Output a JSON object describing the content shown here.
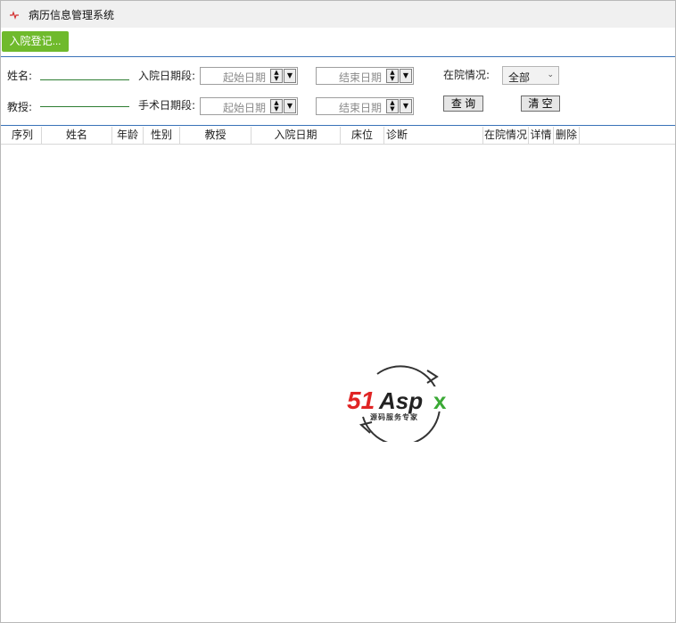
{
  "window": {
    "title": "病历信息管理系统"
  },
  "toolbar": {
    "admit_label": "入院登记..."
  },
  "search": {
    "name_label": "姓名:",
    "admit_period_label": "入院日期段:",
    "status_label": "在院情况:",
    "professor_label": "教授:",
    "surgery_period_label": "手术日期段:",
    "start_date_placeholder": "起始日期",
    "end_date_placeholder": "结束日期",
    "status_value": "全部",
    "query_label": "查 询",
    "clear_label": "清 空"
  },
  "table": {
    "columns": [
      "序列",
      "姓名",
      "年龄",
      "性别",
      "教授",
      "入院日期",
      "床位",
      "诊断",
      "在院情况",
      "详情",
      "删除"
    ],
    "rows": []
  },
  "watermark": {
    "brand": "51Aspx",
    "tagline": "源码服务专家"
  },
  "colors": {
    "accent_green": "#6fba2c",
    "divider_blue": "#3a73b8",
    "logo_red": "#e02424",
    "logo_green": "#3aa935"
  }
}
